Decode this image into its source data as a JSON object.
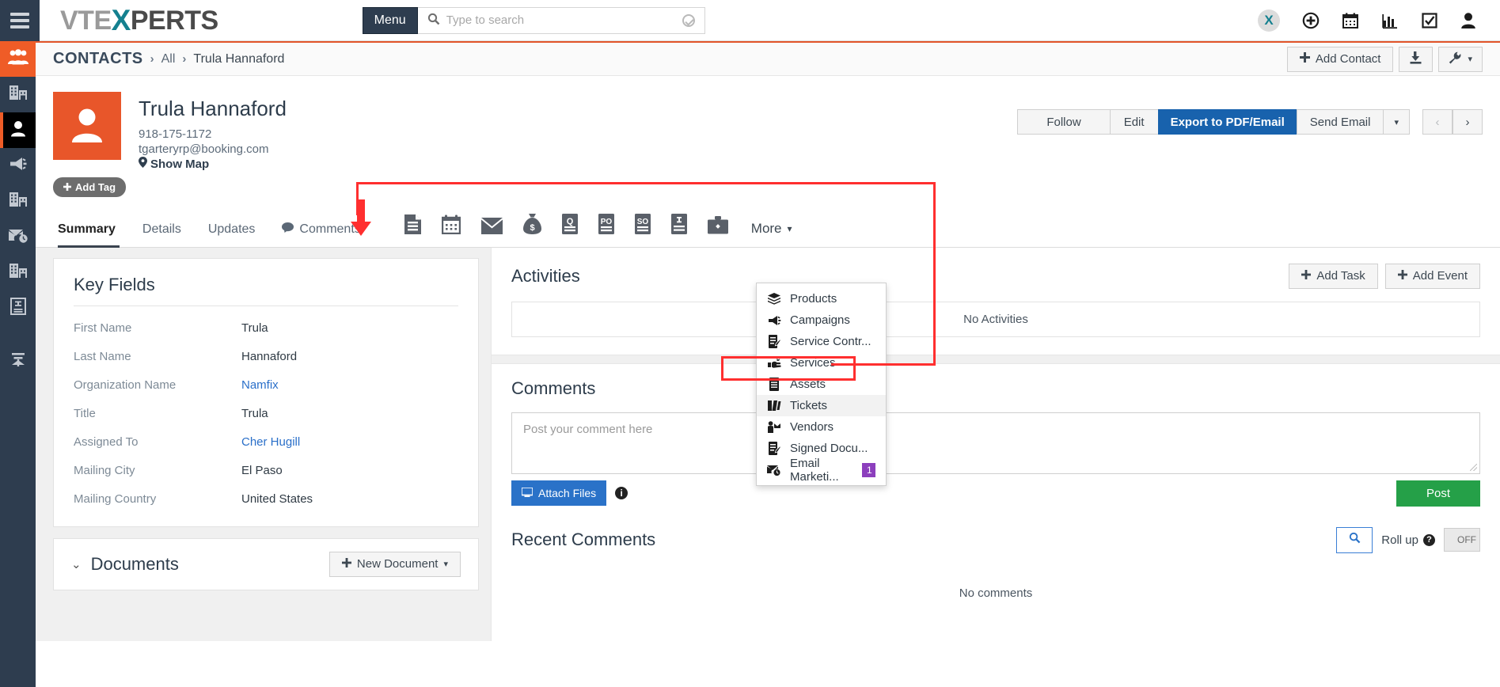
{
  "topbar": {
    "brand_pre": "VTE",
    "brand_x": "X",
    "brand_post": "PERTS",
    "menu_label": "Menu",
    "search_placeholder": "Type to search",
    "search_value": "",
    "icons": [
      "x-logo-badge-icon",
      "plus-circle-icon",
      "calendar-icon",
      "analytics-chart-icon",
      "checklist-icon",
      "user-icon"
    ]
  },
  "sidebar": {
    "items": [
      {
        "name": "leads",
        "icon": "people-group-icon",
        "state": "active-orange"
      },
      {
        "name": "organizations",
        "icon": "building-icon",
        "state": ""
      },
      {
        "name": "contacts",
        "icon": "person-icon",
        "state": "active-black"
      },
      {
        "name": "campaigns",
        "icon": "megaphone-icon",
        "state": ""
      },
      {
        "name": "organizations-2",
        "icon": "building-icon",
        "state": ""
      },
      {
        "name": "email-scheduled",
        "icon": "email-clock-icon",
        "state": ""
      },
      {
        "name": "organizations-3",
        "icon": "building-icon",
        "state": ""
      },
      {
        "name": "invoices",
        "icon": "invoice-icon",
        "state": ""
      },
      {
        "name": "filter",
        "icon": "funnel-icon",
        "state": ""
      }
    ]
  },
  "breadcrumb": {
    "module": "CONTACTS",
    "sep": "›",
    "view": "All",
    "current": "Trula Hannaford",
    "add_label": "Add Contact",
    "import_icon": "import-download-icon",
    "settings_icon": "wrench-icon"
  },
  "contact": {
    "name": "Trula Hannaford",
    "phone": "918-175-1172",
    "email": "tgarteryrp@booking.com",
    "show_map": "Show Map",
    "avatar_icon": "person-avatar-icon",
    "add_tag": "Add Tag",
    "actions": {
      "follow": "Follow",
      "edit": "Edit",
      "export": "Export to PDF/Email",
      "send_email": "Send Email",
      "caret": "▾",
      "prev": "‹",
      "next": "›"
    }
  },
  "tabs": {
    "text_tabs": [
      {
        "label": "Summary",
        "active": true,
        "icon": ""
      },
      {
        "label": "Details",
        "active": false,
        "icon": ""
      },
      {
        "label": "Updates",
        "active": false,
        "icon": ""
      },
      {
        "label": "Comments",
        "active": false,
        "icon": "comment-bubble-icon"
      }
    ],
    "icon_tabs": [
      "document-icon",
      "calendar-icon",
      "envelope-icon",
      "money-bag-icon",
      "quote-q-icon",
      "purchase-order-po-icon",
      "sales-order-so-icon",
      "invoice-i-icon",
      "briefcase-project-icon"
    ],
    "more_label": "More",
    "more_caret": "▾"
  },
  "dropdown": {
    "items": [
      {
        "label": "Products",
        "icon": "products-box-icon",
        "highlighted": false,
        "badge": ""
      },
      {
        "label": "Campaigns",
        "icon": "megaphone-icon",
        "highlighted": false,
        "badge": ""
      },
      {
        "label": "Service Contr...",
        "icon": "contract-pencil-icon",
        "highlighted": false,
        "badge": ""
      },
      {
        "label": "Services",
        "icon": "service-hand-icon",
        "highlighted": false,
        "badge": ""
      },
      {
        "label": "Assets",
        "icon": "asset-server-icon",
        "highlighted": false,
        "badge": ""
      },
      {
        "label": "Tickets",
        "icon": "ticket-icon",
        "highlighted": true,
        "badge": ""
      },
      {
        "label": "Vendors",
        "icon": "vendor-person-icon",
        "highlighted": false,
        "badge": ""
      },
      {
        "label": "Signed Docu...",
        "icon": "signed-document-icon",
        "highlighted": false,
        "badge": ""
      },
      {
        "label": "Email Marketi...",
        "icon": "email-marketing-icon",
        "highlighted": false,
        "badge": "1"
      }
    ]
  },
  "key_fields": {
    "title": "Key Fields",
    "rows": [
      {
        "label": "First Name",
        "value": "Trula",
        "link": false
      },
      {
        "label": "Last Name",
        "value": "Hannaford",
        "link": false
      },
      {
        "label": "Organization Name",
        "value": "Namfix",
        "link": true
      },
      {
        "label": "Title",
        "value": "Trula",
        "link": false
      },
      {
        "label": "Assigned To",
        "value": "Cher Hugill",
        "link": true
      },
      {
        "label": "Mailing City",
        "value": "El Paso",
        "link": false
      },
      {
        "label": "Mailing Country",
        "value": "United States",
        "link": false
      }
    ]
  },
  "documents": {
    "title": "Documents",
    "chevron": "⌄",
    "new_label": "New Document",
    "caret": "▾"
  },
  "activities": {
    "title": "Activities",
    "add_task": "Add Task",
    "add_event": "Add Event",
    "empty_text": "No Activities"
  },
  "comments": {
    "title": "Comments",
    "placeholder": "Post your comment here",
    "value": "",
    "attach_label": "Attach Files",
    "info_glyph": "i",
    "post_label": "Post"
  },
  "recent_comments": {
    "title": "Recent Comments",
    "search_icon": "search-icon",
    "rollup_label": "Roll up",
    "help_glyph": "?",
    "toggle_state": "OFF",
    "empty_text": "No comments"
  },
  "colors": {
    "accent_orange": "#e8562a",
    "sidebar_dark": "#2e3d4f",
    "primary_blue": "#1862ad",
    "post_green": "#25a048",
    "badge_purple": "#8c3fbd",
    "annotation_red": "#ff2f2f",
    "brand_teal": "#14808f"
  }
}
